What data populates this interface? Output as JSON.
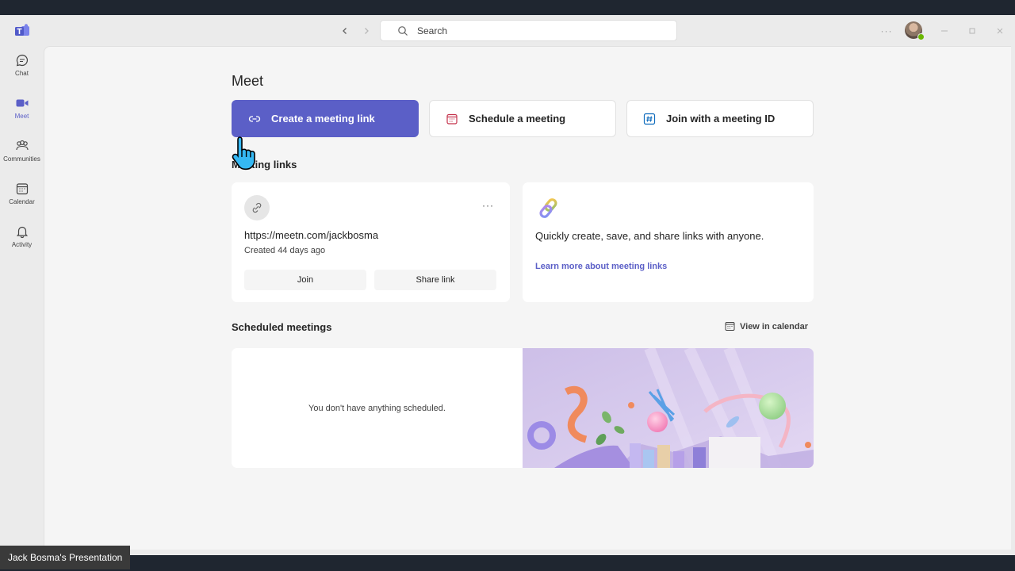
{
  "search": {
    "placeholder": "Search"
  },
  "rail": {
    "items": [
      {
        "label": "Chat"
      },
      {
        "label": "Meet"
      },
      {
        "label": "Communities"
      },
      {
        "label": "Calendar"
      },
      {
        "label": "Activity"
      }
    ]
  },
  "meet": {
    "title": "Meet",
    "actions": {
      "create": "Create a meeting link",
      "schedule": "Schedule a meeting",
      "join_id": "Join with a meeting ID"
    },
    "meeting_links": {
      "title": "Meeting links",
      "link": {
        "url": "https://meetn.com/jackbosma",
        "created": "Created 44 days ago",
        "join_label": "Join",
        "share_label": "Share link"
      },
      "promo": {
        "text": "Quickly create, save, and share links with anyone.",
        "learn_more": "Learn more about meeting links"
      }
    },
    "scheduled": {
      "title": "Scheduled meetings",
      "view_calendar": "View in calendar",
      "empty": "You don't have anything scheduled."
    }
  },
  "caption": "Jack Bosma's Presentation",
  "colors": {
    "accent": "#5b5fc7",
    "background": "#f5f5f5",
    "presence": "#6bb700"
  }
}
